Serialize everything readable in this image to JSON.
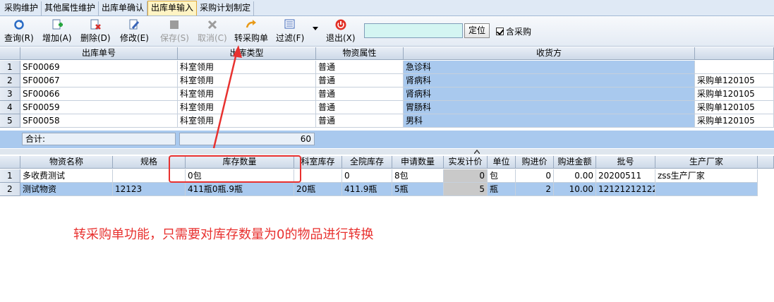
{
  "tabs": [
    "采购维护",
    "其他属性维护",
    "出库单确认",
    "出库单输入",
    "采购计划制定"
  ],
  "toolbar": {
    "query": "查询(R)",
    "add": "增加(A)",
    "delete": "删除(D)",
    "edit": "修改(E)",
    "save": "保存(S)",
    "cancel": "取消(C)",
    "to_purchase": "转采购单",
    "filter": "过滤(F)",
    "exit": "退出(X)",
    "search_value": "",
    "locate": "定位",
    "include_purchase": "含采购",
    "include_purchase_checked": true
  },
  "grid1": {
    "headers": [
      "出库单号",
      "出库类型",
      "物资属性",
      "收货方",
      ""
    ],
    "rows": [
      {
        "num": "1",
        "no": "SF00069",
        "type": "科室领用",
        "attr": "普通",
        "receiver": "急诊科",
        "extra": ""
      },
      {
        "num": "2",
        "no": "SF00067",
        "type": "科室领用",
        "attr": "普通",
        "receiver": "肾病科",
        "extra": "采购单120105"
      },
      {
        "num": "3",
        "no": "SF00066",
        "type": "科室领用",
        "attr": "普通",
        "receiver": "肾病科",
        "extra": "采购单120105"
      },
      {
        "num": "4",
        "no": "SF00059",
        "type": "科室领用",
        "attr": "普通",
        "receiver": "胃肠科",
        "extra": "采购单120105"
      },
      {
        "num": "5",
        "no": "SF00058",
        "type": "科室领用",
        "attr": "普通",
        "receiver": "男科",
        "extra": "采购单120105"
      }
    ],
    "sum_label": "合计:",
    "sum_value": "60"
  },
  "grid2": {
    "headers": [
      "物资名称",
      "规格",
      "库存数量",
      "科室库存",
      "全院库存",
      "申请数量",
      "实发计价",
      "单位",
      "购进价",
      "购进金额",
      "批号",
      "生产厂家"
    ],
    "rows": [
      {
        "num": "1",
        "name": "多收费测试",
        "spec": "",
        "stock": "0包",
        "dept": "",
        "hosp": "0",
        "apply": "8包",
        "actual": "0",
        "unit": "包",
        "price": "0",
        "amount": "0.00",
        "batch": "20200511",
        "maker": "zss生产厂家"
      },
      {
        "num": "2",
        "name": "测试物资",
        "spec": "12123",
        "stock": "411瓶0瓶.9瓶",
        "dept": "20瓶",
        "hosp": "411.9瓶",
        "apply": "5瓶",
        "actual": "5",
        "unit": "瓶",
        "price": "2",
        "amount": "10.00",
        "batch": "12121212122",
        "maker": ""
      }
    ]
  },
  "annotation": "转采购单功能，只需要对库存数量为0的物品进行转换",
  "colors": {
    "highlight": "#a9c9ee",
    "annotation": "#e8312f",
    "search_bg": "#d4f5f2"
  }
}
